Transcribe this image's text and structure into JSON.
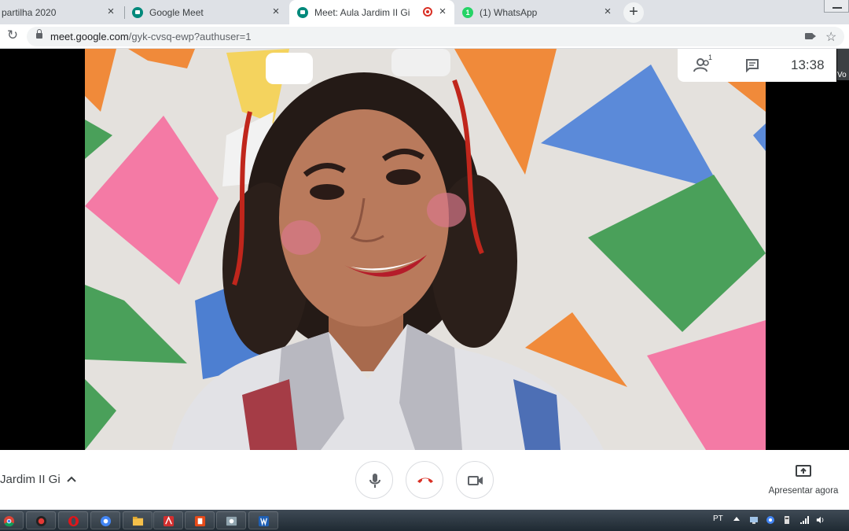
{
  "browser": {
    "tabs": [
      {
        "label": "partilha 2020",
        "active": false,
        "favicon": "none"
      },
      {
        "label": "Google Meet",
        "active": false,
        "favicon": "meet-icon"
      },
      {
        "label": "Meet: Aula Jardim II Gi",
        "active": true,
        "favicon": "meet-icon",
        "recording": true
      },
      {
        "label": "(1) WhatsApp",
        "active": false,
        "favicon": "whatsapp-icon",
        "badge": "1"
      }
    ],
    "tab_close_glyph": "×",
    "new_tab_glyph": "+",
    "url_host": "meet.google.com",
    "url_path": "/gyk-cvsq-ewp?authuser=1"
  },
  "meet": {
    "participants_count": "1",
    "clock": "13:38",
    "right_tile_label": "Vo",
    "meeting_name": "Jardim II Gi",
    "present_label": "Apresentar agora"
  },
  "taskbar": {
    "language": "PT",
    "apps": [
      "chrome-icon",
      "record-icon",
      "opera-icon",
      "chrome-alt-icon",
      "file-explorer-icon",
      "acrobat-icon",
      "office-icon",
      "photos-icon",
      "word-icon"
    ]
  },
  "colors": {
    "meet_green": "#00897b",
    "whatsapp_green": "#25d366",
    "hangup_red": "#d93025",
    "icon_gray": "#5f6368"
  }
}
